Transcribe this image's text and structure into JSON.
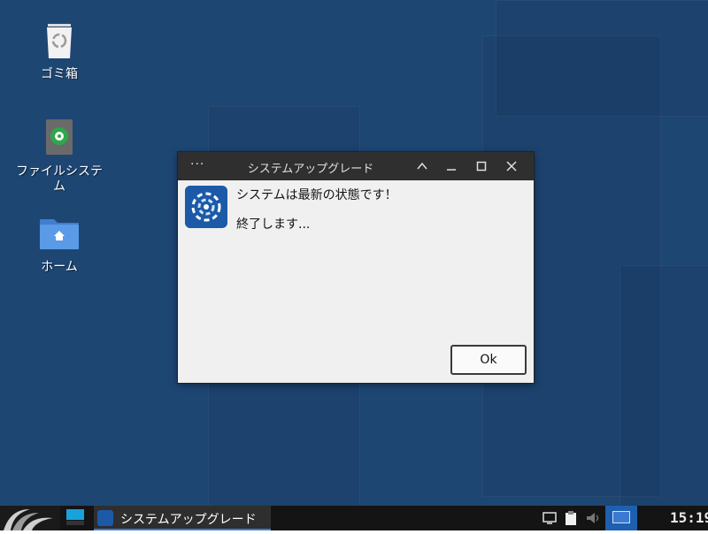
{
  "desktop": {
    "icons": [
      {
        "label": "ゴミ箱",
        "icon": "trash-icon"
      },
      {
        "label": "ファイルシステム",
        "icon": "drive-icon"
      },
      {
        "label": "ホーム",
        "icon": "home-folder-icon"
      }
    ]
  },
  "dialog": {
    "menu_label": "···",
    "title": "システムアップグレード",
    "message_line1": "システムは最新の状態です！",
    "message_line2": "終了します...",
    "ok_label": "Ok",
    "app_icon": "upgrade-app-icon"
  },
  "taskbar": {
    "task_label": "システムアップグレード",
    "clock": "15:19",
    "colors": {
      "accent": "#1d5fb0",
      "bar": "#141414"
    }
  }
}
